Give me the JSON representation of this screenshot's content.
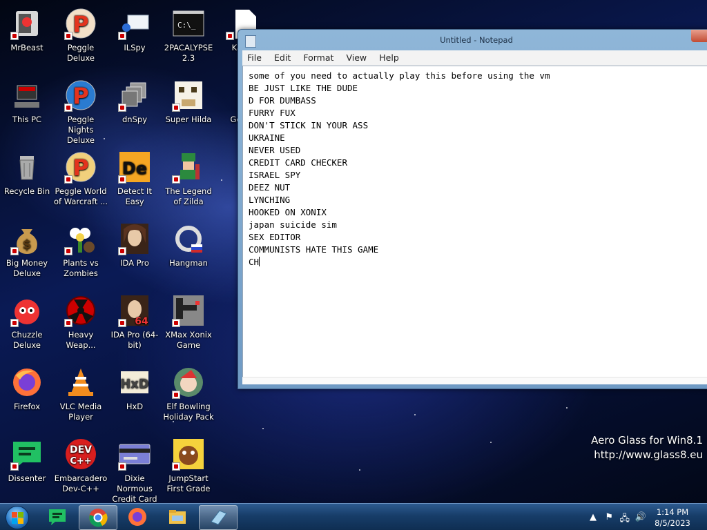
{
  "desktop": {
    "icons": [
      {
        "label": "MrBeast"
      },
      {
        "label": "Peggle Deluxe"
      },
      {
        "label": "ILSpy"
      },
      {
        "label": "2PACALYPSE 2.3"
      },
      {
        "label": "Ka Fa"
      },
      {
        "label": "This PC"
      },
      {
        "label": "Peggle Nights Deluxe"
      },
      {
        "label": "dnSpy"
      },
      {
        "label": "Super Hilda"
      },
      {
        "label": "Go Ch"
      },
      {
        "label": "Recycle Bin"
      },
      {
        "label": "Peggle World of Warcraft ..."
      },
      {
        "label": "Detect It Easy"
      },
      {
        "label": "The Legend of Zilda"
      },
      {
        "label": "Big Money Deluxe"
      },
      {
        "label": "Plants vs Zombies"
      },
      {
        "label": "IDA Pro"
      },
      {
        "label": "Hangman"
      },
      {
        "label": "Chuzzle Deluxe"
      },
      {
        "label": "Heavy Weap..."
      },
      {
        "label": "IDA Pro (64-bit)"
      },
      {
        "label": "XMax Xonix Game"
      },
      {
        "label": "Firefox"
      },
      {
        "label": "VLC Media Player"
      },
      {
        "label": "HxD"
      },
      {
        "label": "Elf Bowling Holiday Pack"
      },
      {
        "label": "Dissenter"
      },
      {
        "label": "Embarcadero Dev-C++"
      },
      {
        "label": "Dixie Normous Credit Card ..."
      },
      {
        "label": "JumpStart First Grade"
      }
    ]
  },
  "notepad": {
    "title": "Untitled - Notepad",
    "menu": [
      "File",
      "Edit",
      "Format",
      "View",
      "Help"
    ],
    "lines": [
      "some of you need to actually play this before using the vm",
      "BE JUST LIKE THE DUDE",
      "D FOR DUMBASS",
      "FURRY FUX",
      "DON'T STICK IN YOUR ASS",
      "UKRAINE",
      "NEVER USED",
      "CREDIT CARD CHECKER",
      "ISRAEL SPY",
      "DEEZ NUT",
      "LYNCHING",
      "HOOKED ON XONIX",
      "japan suicide sim",
      "SEX EDITOR",
      "COMMUNISTS HATE THIS GAME",
      "CH"
    ]
  },
  "watermark": {
    "line1": "Aero Glass for Win8.1",
    "line2": "http://www.glass8.eu"
  },
  "taskbar": {
    "pinned": [
      {
        "icon": "dissenter-icon"
      },
      {
        "icon": "chrome-icon"
      },
      {
        "icon": "firefox-icon"
      },
      {
        "icon": "file-explorer-icon"
      },
      {
        "icon": "notepad-icon"
      }
    ],
    "clock": {
      "time": "1:14 PM",
      "date": "8/5/2023"
    }
  }
}
